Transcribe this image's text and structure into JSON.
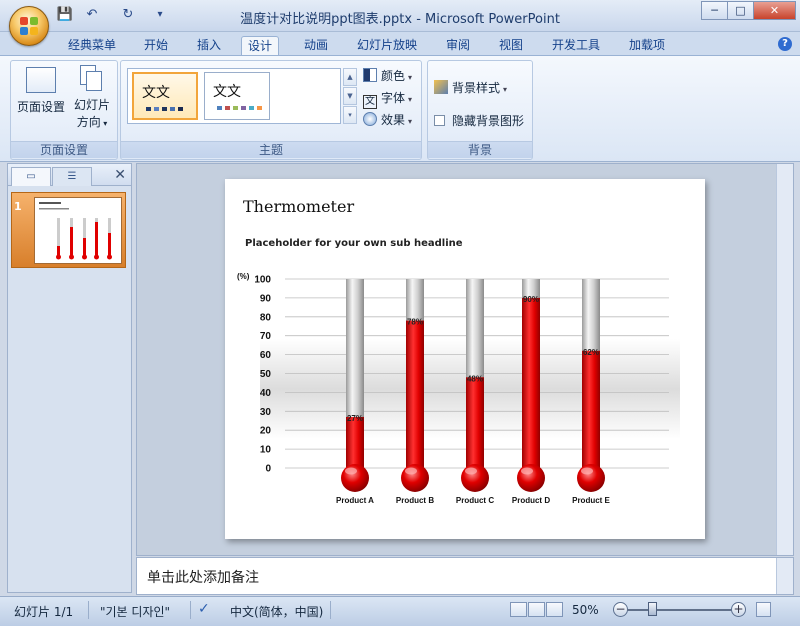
{
  "window": {
    "title": "温度计对比说明ppt图表.pptx - Microsoft PowerPoint",
    "minimize": "─",
    "maximize": "□",
    "close": "✕"
  },
  "qat": {
    "save": "💾",
    "undo": "↶",
    "redo": "↻",
    "more": "▾"
  },
  "tabs": [
    "经典菜单",
    "开始",
    "插入",
    "设计",
    "动画",
    "幻灯片放映",
    "审阅",
    "视图",
    "开发工具",
    "加载项"
  ],
  "active_tab": "设计",
  "help_icon": "?",
  "ribbon": {
    "page_setup": {
      "btn1": "页面设置",
      "btn2_line1": "幻灯片",
      "btn2_line2": "方向",
      "group_label": "页面设置"
    },
    "theme": {
      "thumb1_text": "文文",
      "thumb2_text": "文文",
      "colors": "颜色",
      "fonts": "字体",
      "effects": "效果",
      "group_label": "主题"
    },
    "background": {
      "styles": "背景样式",
      "hide_graphics": "隐藏背景图形",
      "group_label": "背景"
    }
  },
  "slides_pane": {
    "slide_number": "1"
  },
  "slide": {
    "title": "Thermometer",
    "subtitle": "Placeholder for your own sub headline"
  },
  "chart_data": {
    "type": "bar",
    "style": "thermometer",
    "unit_label": "(%)",
    "categories": [
      "Product A",
      "Product B",
      "Product C",
      "Product D",
      "Product E"
    ],
    "values": [
      27,
      78,
      48,
      90,
      62
    ],
    "value_labels": [
      "27%",
      "78%",
      "48%",
      "90%",
      "62%"
    ],
    "ylim": [
      0,
      100
    ],
    "yticks": [
      100,
      90,
      80,
      70,
      60,
      50,
      40,
      30,
      20,
      10,
      0
    ],
    "grid": true,
    "fill_color": "#e00000",
    "tube_color": "#c8c8c8"
  },
  "notes": {
    "placeholder": "单击此处添加备注"
  },
  "status": {
    "slide_info": "幻灯片 1/1",
    "theme_name": "\"기본 디자인\"",
    "language": "中文(简体，中国)",
    "zoom": "50%"
  }
}
